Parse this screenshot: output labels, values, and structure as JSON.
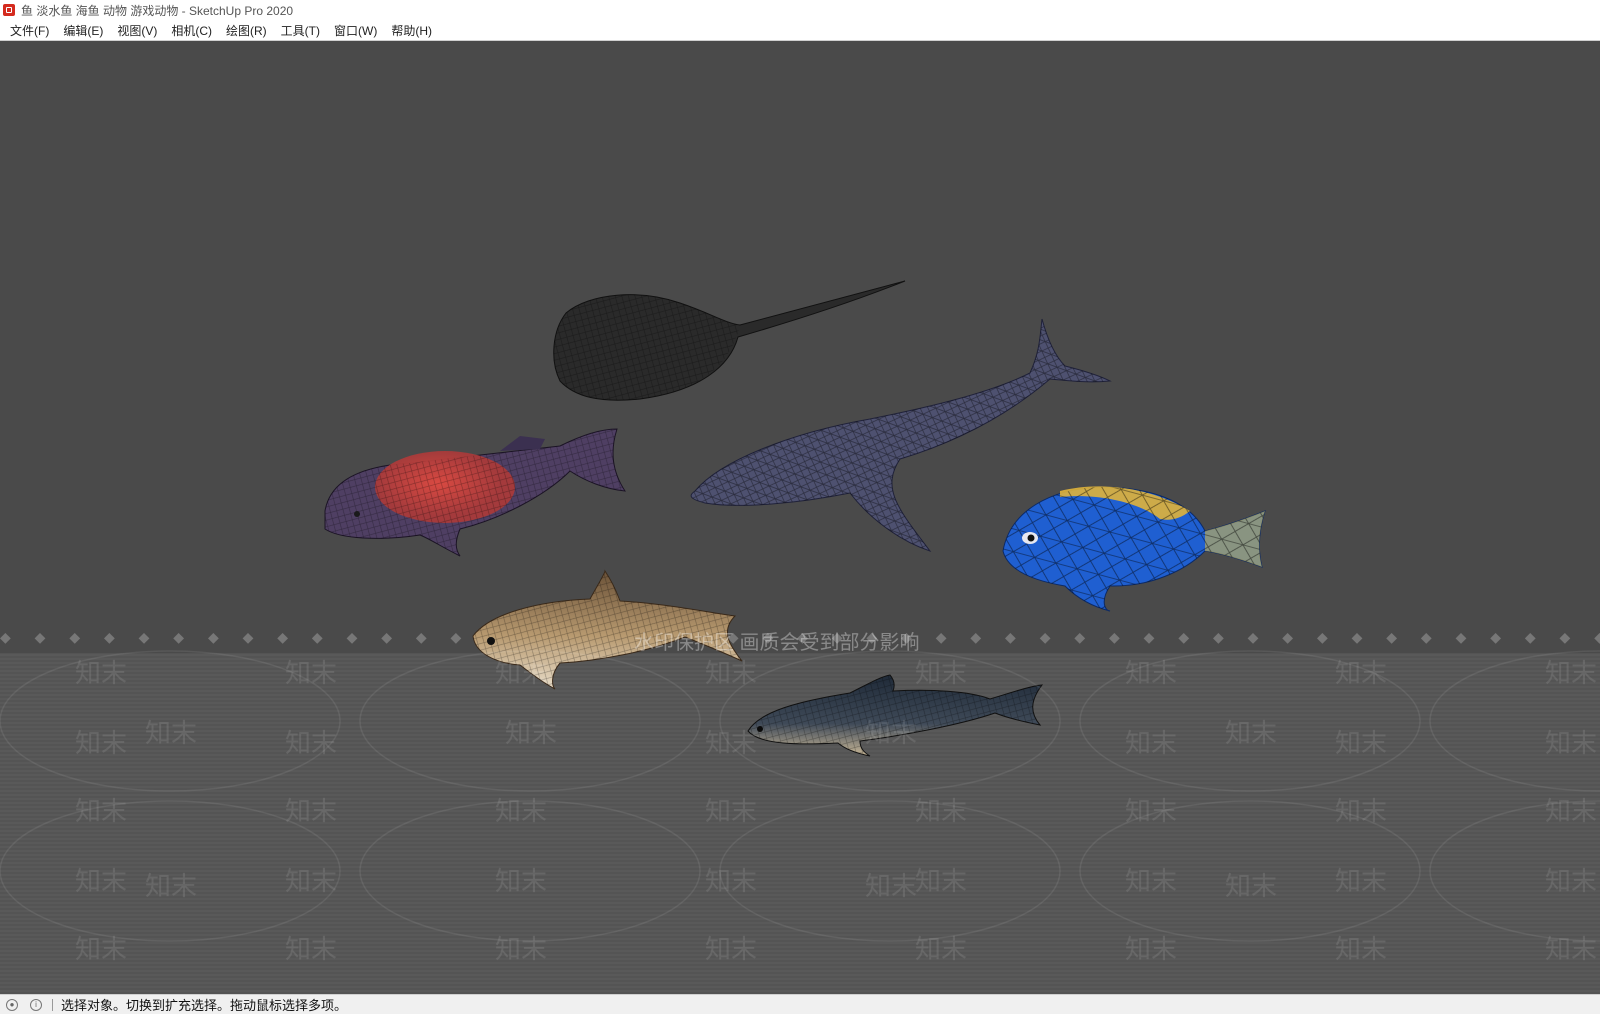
{
  "window": {
    "title": "鱼 淡水鱼 海鱼 动物 游戏动物 - SketchUp Pro 2020"
  },
  "menu": {
    "items": [
      {
        "label": "文件(F)"
      },
      {
        "label": "编辑(E)"
      },
      {
        "label": "视图(V)"
      },
      {
        "label": "相机(C)"
      },
      {
        "label": "绘图(R)"
      },
      {
        "label": "工具(T)"
      },
      {
        "label": "窗口(W)"
      },
      {
        "label": "帮助(H)"
      }
    ]
  },
  "viewport": {
    "background_color": "#4a4a4a",
    "models": [
      {
        "name": "stingray",
        "color": "#2b2b2b"
      },
      {
        "name": "humpback-whale",
        "color": "#4e5170"
      },
      {
        "name": "red-banded-fish",
        "color": "#c0433b"
      },
      {
        "name": "blue-tang",
        "color": "#1f5fd1"
      },
      {
        "name": "brown-fish",
        "color": "#8a6a48"
      },
      {
        "name": "dark-slender-fish",
        "color": "#2e3440"
      }
    ],
    "watermark": {
      "notice": "水印保护区  画质会受到部分影响",
      "brand": "知末",
      "dots": "◆ ◆ ◆ ◆ ◆ ◆ ◆ ◆ ◆ ◆ ◆ ◆ ◆ ◆ ◆ ◆ ◆ ◆ ◆ ◆ ◆ ◆ ◆ ◆ ◆ ◆ ◆ ◆ ◆ ◆ ◆ ◆ ◆ ◆ ◆ ◆ ◆ ◆ ◆ ◆ ◆ ◆ ◆ ◆ ◆ ◆ ◆ ◆ ◆ ◆ ◆ ◆ ◆ ◆ ◆ ◆ ◆ ◆"
    }
  },
  "status": {
    "text": "选择对象。切换到扩充选择。拖动鼠标选择多项。"
  }
}
